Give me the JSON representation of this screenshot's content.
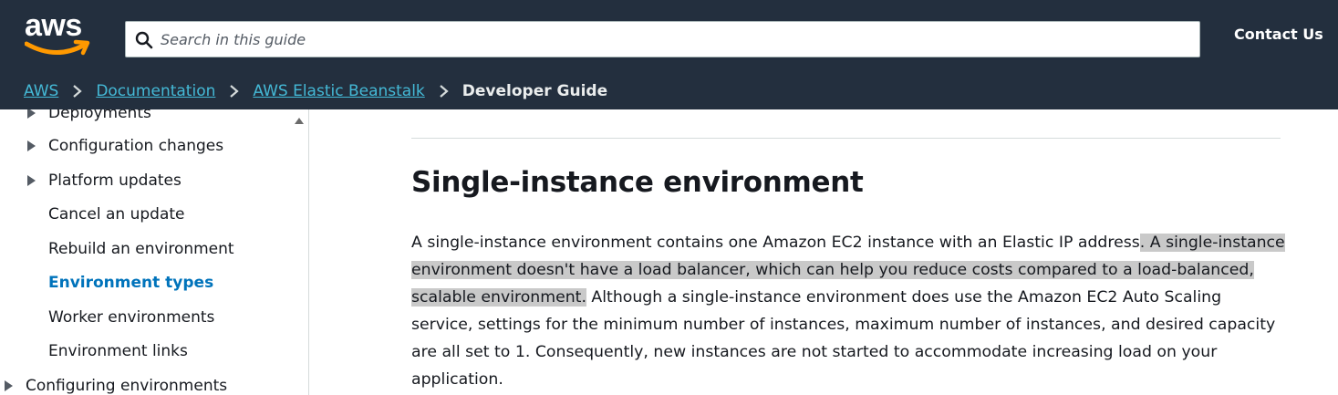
{
  "header": {
    "logo_text": "aws",
    "search_placeholder": "Search in this guide",
    "contact_label": "Contact Us"
  },
  "breadcrumb": {
    "items": [
      "AWS",
      "Documentation",
      "AWS Elastic Beanstalk"
    ],
    "current": "Developer Guide"
  },
  "sidebar": {
    "items": [
      {
        "label": "Deployments",
        "expandable": true
      },
      {
        "label": "Configuration changes",
        "expandable": true
      },
      {
        "label": "Platform updates",
        "expandable": true
      },
      {
        "label": "Cancel an update",
        "expandable": false
      },
      {
        "label": "Rebuild an environment",
        "expandable": false
      },
      {
        "label": "Environment types",
        "expandable": false,
        "active": true
      },
      {
        "label": "Worker environments",
        "expandable": false
      },
      {
        "label": "Environment links",
        "expandable": false
      },
      {
        "label": "Configuring environments",
        "expandable": true
      }
    ]
  },
  "main": {
    "title": "Single-instance environment",
    "paragraph": {
      "part1": "A single-instance environment contains one Amazon EC2 instance with an Elastic IP address",
      "part2": ". A single-instance environment doesn't have a load balancer, which can help you reduce costs compared to a load-balanced, scalable environment.",
      "part3": " Although a single-instance environment does use the Amazon EC2 Auto Scaling service, settings for the minimum number of instances, maximum number of instances, and desired capacity are all set to 1. Consequently, new instances are not started to accommodate increasing load on your application."
    }
  },
  "colors": {
    "header_bg": "#232f3e",
    "link": "#44b9d6",
    "active_nav": "#0073bb",
    "logo_smile": "#ff9900",
    "highlight": "#c9c9c9"
  }
}
